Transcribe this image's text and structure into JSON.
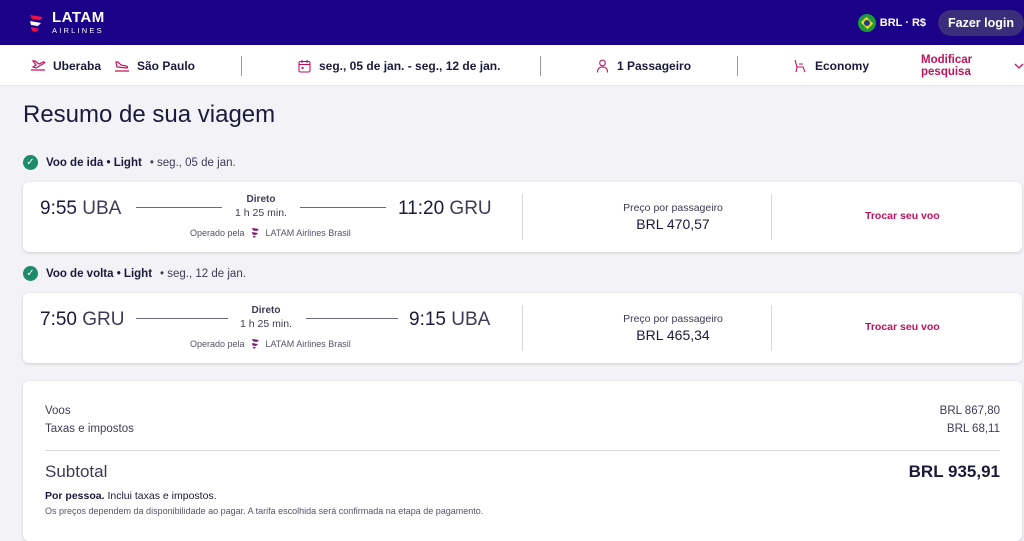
{
  "brand": {
    "line1": "LATAM",
    "line2": "AIRLINES"
  },
  "header": {
    "currency": "BRL · R$",
    "login_label": "Fazer login"
  },
  "search": {
    "origin": "Uberaba",
    "destination": "São Paulo",
    "dates": "seg., 05 de jan. - seg., 12 de jan.",
    "passengers": "1 Passageiro",
    "cabin": "Economy",
    "modify_label": "Modificar pesquisa"
  },
  "page": {
    "title": "Resumo de sua viagem"
  },
  "outbound": {
    "header_bold": "Voo de ida • Light",
    "header_date": "• seg., 05 de jan.",
    "dep_time": "9:55",
    "dep_airport": "UBA",
    "arr_time": "11:20",
    "arr_airport": "GRU",
    "stops": "Direto",
    "duration": "1 h 25 min.",
    "operated_label": "Operado pela",
    "operator": "LATAM Airlines Brasil",
    "price_label": "Preço por passageiro",
    "price": "BRL 470,57",
    "change_label": "Trocar seu voo"
  },
  "return": {
    "header_bold": "Voo de volta • Light",
    "header_date": "• seg., 12 de jan.",
    "dep_time": "7:50",
    "dep_airport": "GRU",
    "arr_time": "9:15",
    "arr_airport": "UBA",
    "stops": "Direto",
    "duration": "1 h 25 min.",
    "operated_label": "Operado pela",
    "operator": "LATAM Airlines Brasil",
    "price_label": "Preço por passageiro",
    "price": "BRL 465,34",
    "change_label": "Trocar seu voo"
  },
  "summary": {
    "flights_label": "Voos",
    "flights_value": "BRL 867,80",
    "taxes_label": "Taxas e impostos",
    "taxes_value": "BRL 68,11",
    "subtotal_label": "Subtotal",
    "subtotal_value": "BRL 935,91",
    "per_person_bold": "Por pessoa.",
    "per_person_rest": " Inclui taxas e impostos.",
    "disclaimer": "Os preços dependem da disponibilidade ao pagar. A tarifa escolhida será confirmada na etapa de pagamento."
  },
  "colors": {
    "header_bg": "#1b0088",
    "accent": "#c0135a",
    "check": "#1c8a6c"
  },
  "icons": [
    "latam-logo-icon",
    "brazil-flag-icon",
    "takeoff-icon",
    "landing-icon",
    "calendar-icon",
    "person-icon",
    "seat-icon",
    "chevron-down-icon",
    "check-icon"
  ]
}
